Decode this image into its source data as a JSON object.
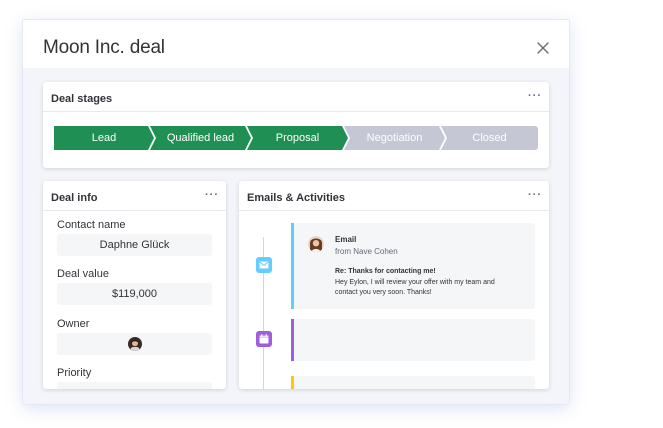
{
  "modal": {
    "title": "Moon Inc. deal"
  },
  "stages_card": {
    "title": "Deal stages",
    "menu": "···",
    "stages": [
      {
        "label": "Lead",
        "status": "complete"
      },
      {
        "label": "Qualified lead",
        "status": "complete"
      },
      {
        "label": "Proposal",
        "status": "complete"
      },
      {
        "label": "Negotiation",
        "status": "pending"
      },
      {
        "label": "Closed",
        "status": "pending"
      }
    ]
  },
  "info_card": {
    "title": "Deal info",
    "menu": "···",
    "fields": {
      "contact": {
        "label": "Contact name",
        "value": "Daphne Glück"
      },
      "deal_value": {
        "label": "Deal value",
        "value": "$119,000"
      },
      "owner": {
        "label": "Owner",
        "value_icon": "owner-avatar"
      },
      "priority": {
        "label": "Priority"
      }
    }
  },
  "emails_card": {
    "title": "Emails & Activities",
    "menu": "···",
    "activities": [
      {
        "type": "Email",
        "from": "from Nave Cohen",
        "subject": "Re: Thanks for contacting me!",
        "body": "Hey Eylon, I will review your offer with my team and contact you very soon. Thanks!",
        "icon": "mail-icon",
        "accent": "#66ccff"
      },
      {
        "icon": "calendar-icon",
        "accent": "#a25ddc"
      },
      {
        "icon": "activity-icon",
        "accent": "#ffcb00"
      }
    ]
  },
  "colors": {
    "stage_complete": "#1f8f53",
    "stage_pending": "#c5c7d4",
    "mail_icon_bg": "#66ccff",
    "calendar_icon_bg": "#a25ddc"
  }
}
